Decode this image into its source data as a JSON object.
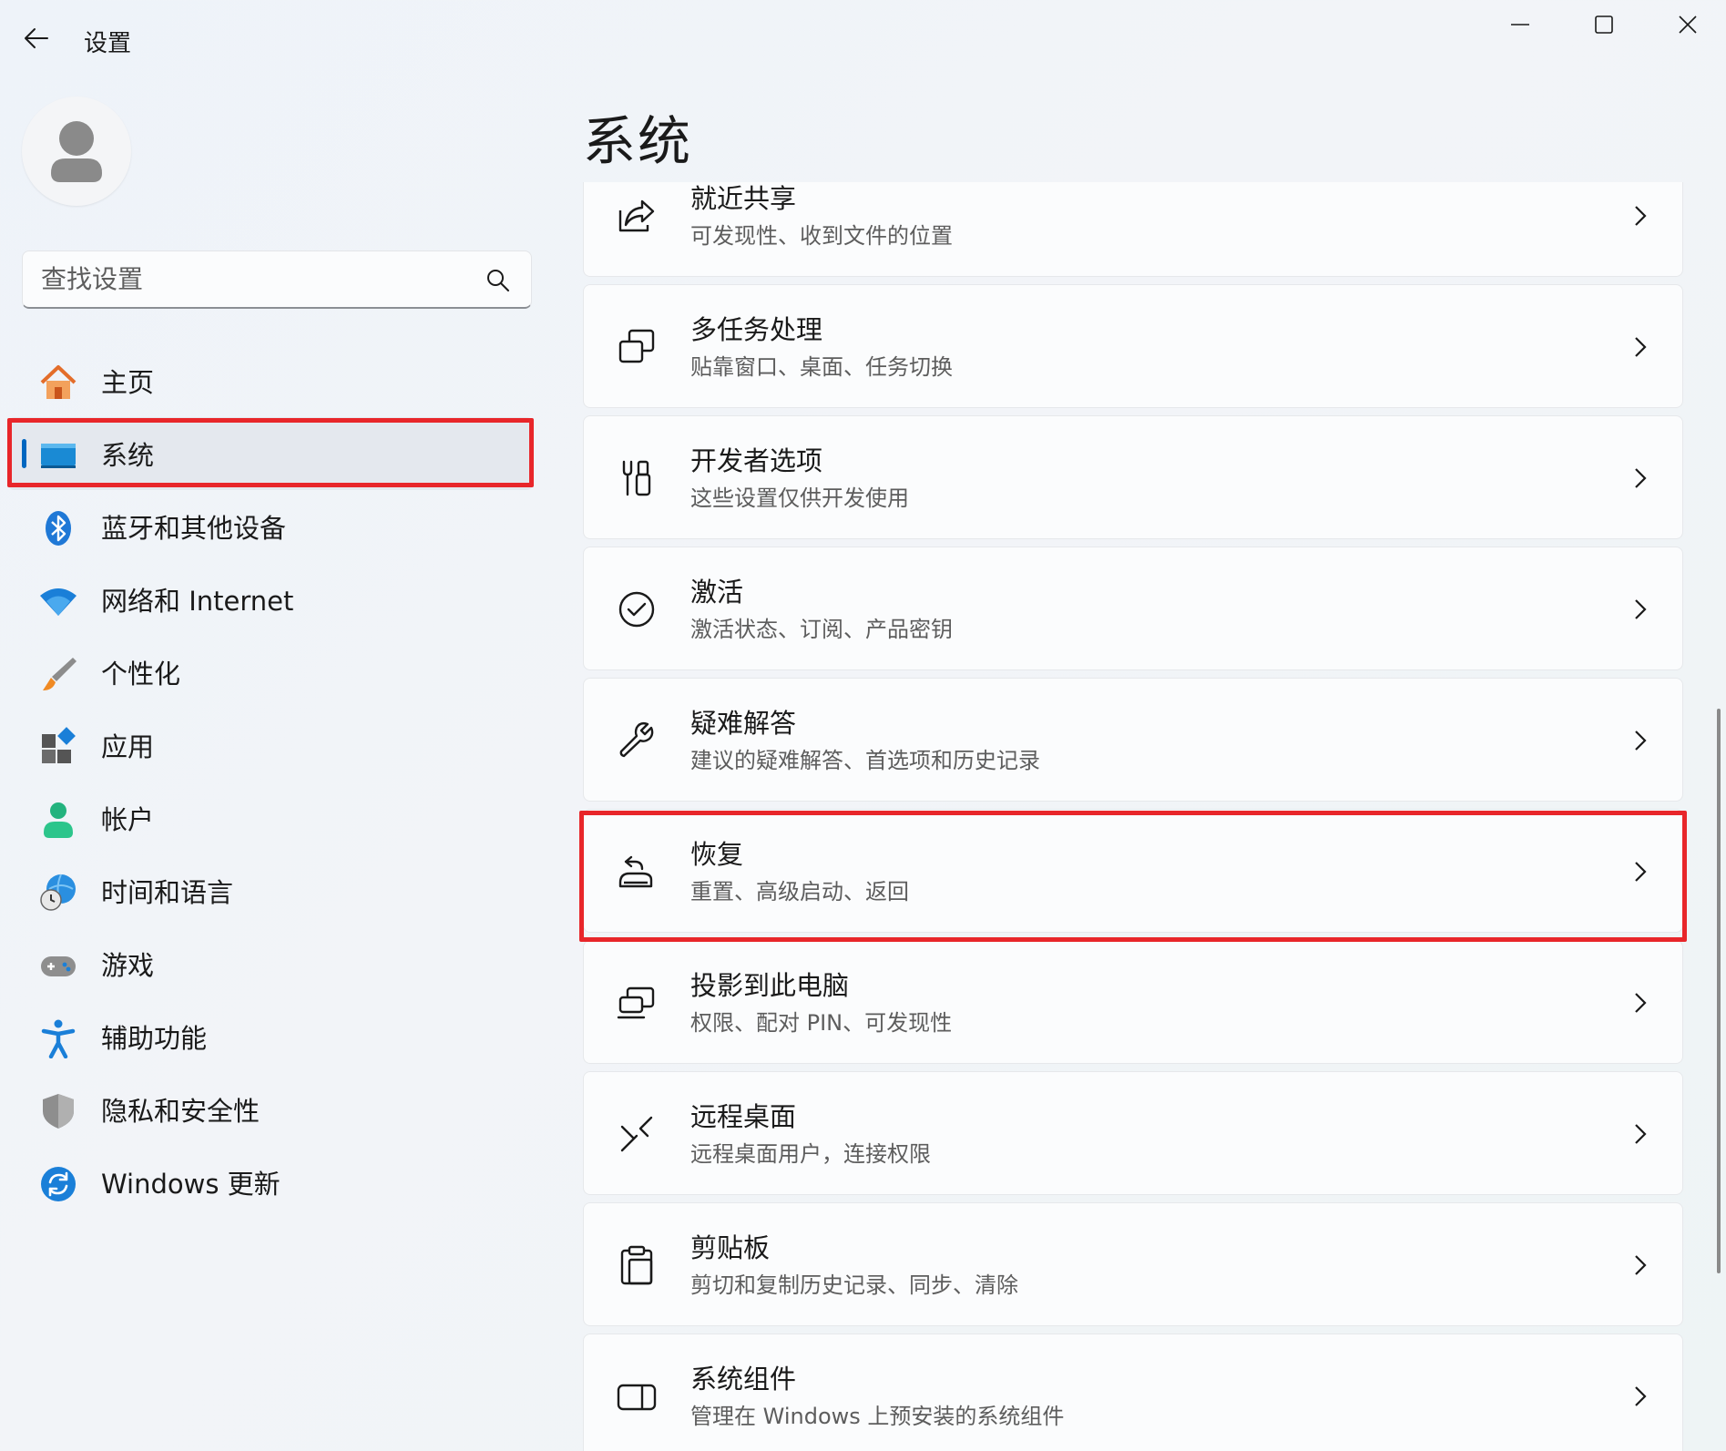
{
  "window": {
    "title": "设置",
    "controls": [
      "minimize-icon",
      "maximize-icon",
      "close-icon"
    ]
  },
  "search": {
    "placeholder": "查找设置"
  },
  "sidebar": {
    "items": [
      {
        "label": "主页",
        "icon": "home-icon"
      },
      {
        "label": "系统",
        "icon": "system-display-icon",
        "selected": true
      },
      {
        "label": "蓝牙和其他设备",
        "icon": "bluetooth-icon"
      },
      {
        "label": "网络和 Internet",
        "icon": "wifi-icon"
      },
      {
        "label": "个性化",
        "icon": "brush-icon"
      },
      {
        "label": "应用",
        "icon": "apps-icon"
      },
      {
        "label": "帐户",
        "icon": "account-icon"
      },
      {
        "label": "时间和语言",
        "icon": "globe-clock-icon"
      },
      {
        "label": "游戏",
        "icon": "gamepad-icon"
      },
      {
        "label": "辅助功能",
        "icon": "accessibility-icon"
      },
      {
        "label": "隐私和安全性",
        "icon": "shield-icon"
      },
      {
        "label": "Windows 更新",
        "icon": "update-icon"
      }
    ]
  },
  "main": {
    "title": "系统",
    "cards": [
      {
        "title": "就近共享",
        "subtitle": "可发现性、收到文件的位置",
        "icon": "share-icon"
      },
      {
        "title": "多任务处理",
        "subtitle": "贴靠窗口、桌面、任务切换",
        "icon": "multitask-icon"
      },
      {
        "title": "开发者选项",
        "subtitle": "这些设置仅供开发使用",
        "icon": "developer-tools-icon"
      },
      {
        "title": "激活",
        "subtitle": "激活状态、订阅、产品密钥",
        "icon": "check-circle-icon"
      },
      {
        "title": "疑难解答",
        "subtitle": "建议的疑难解答、首选项和历史记录",
        "icon": "wrench-icon"
      },
      {
        "title": "恢复",
        "subtitle": "重置、高级启动、返回",
        "icon": "recovery-icon"
      },
      {
        "title": "投影到此电脑",
        "subtitle": "权限、配对 PIN、可发现性",
        "icon": "project-icon"
      },
      {
        "title": "远程桌面",
        "subtitle": "远程桌面用户，连接权限",
        "icon": "remote-desktop-icon"
      },
      {
        "title": "剪贴板",
        "subtitle": "剪切和复制历史记录、同步、清除",
        "icon": "clipboard-icon"
      },
      {
        "title": "系统组件",
        "subtitle": "管理在 Windows 上预安装的系统组件",
        "icon": "components-icon"
      }
    ]
  },
  "colors": {
    "accent": "#0067c0",
    "highlight": "#e8262a",
    "background": "#eef3f9"
  }
}
